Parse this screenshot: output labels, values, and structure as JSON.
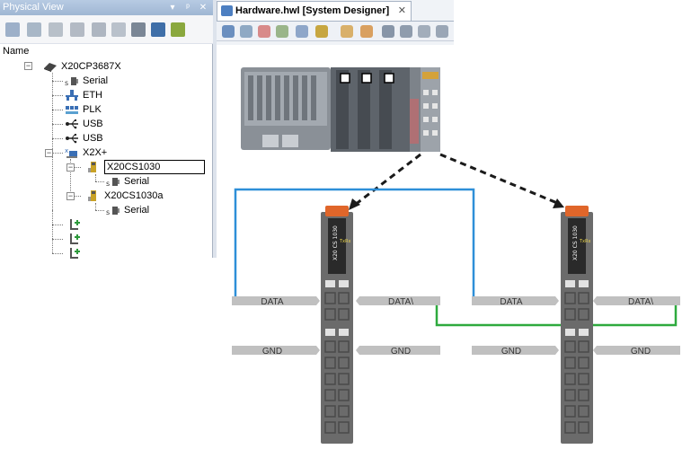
{
  "physical_view": {
    "title": "Physical View",
    "controls": [
      "▾",
      "ᵖ",
      "✕"
    ],
    "column_header": "Name",
    "toolbar_icons": [
      "open-icon",
      "search-icon",
      "settings-icon",
      "refresh-icon",
      "properties-icon",
      "module-icon",
      "find-icon",
      "network-icon",
      "pin-icon"
    ],
    "tree": {
      "root": "X20CP3687X",
      "children": [
        {
          "label": "Serial",
          "icon": "serial-port-icon"
        },
        {
          "label": "ETH",
          "icon": "ethernet-icon"
        },
        {
          "label": "PLK",
          "icon": "powerlink-icon"
        },
        {
          "label": "USB",
          "icon": "usb-icon"
        },
        {
          "label": "USB",
          "icon": "usb-icon"
        },
        {
          "label": "X2X+",
          "icon": "x2x-bus-icon"
        }
      ],
      "x2x_modules": [
        {
          "label": "X20CS1030",
          "child": "Serial",
          "selected": true
        },
        {
          "label": "X20CS1030a",
          "child": "Serial",
          "selected": false
        }
      ],
      "empty_slots": 3
    }
  },
  "system_designer": {
    "tab_label": "Hardware.hwl [System Designer]",
    "tab_close": "✕",
    "toolbar_icons": [
      "undo-icon",
      "search-icon",
      "palette-icon",
      "hardware-icon",
      "network-icon",
      "lock-icon",
      "hand-icon",
      "pointer-icon",
      "align-icon",
      "layout-icon",
      "grid-icon",
      "table-icon"
    ]
  },
  "wiring_diagram": {
    "left_module": {
      "data": "DATA",
      "data_bar": "DATA\\",
      "gnd": "GND",
      "gnd_right": "GND",
      "side_label": "X20 CS 1030",
      "tx": "Tx",
      "rx": "Rx"
    },
    "right_module": {
      "data": "DATA",
      "data_bar": "DATA\\",
      "gnd": "GND",
      "gnd_right": "GND",
      "side_label": "X20 CS 1030",
      "tx": "Tx",
      "rx": "Rx"
    },
    "colors": {
      "data_wire": "#2e8fd8",
      "data_bar_wire": "#2eaa3e",
      "module_body": "#6b6b6b",
      "module_top": "#e0662a",
      "label_bar": "#c0c0c0"
    }
  }
}
